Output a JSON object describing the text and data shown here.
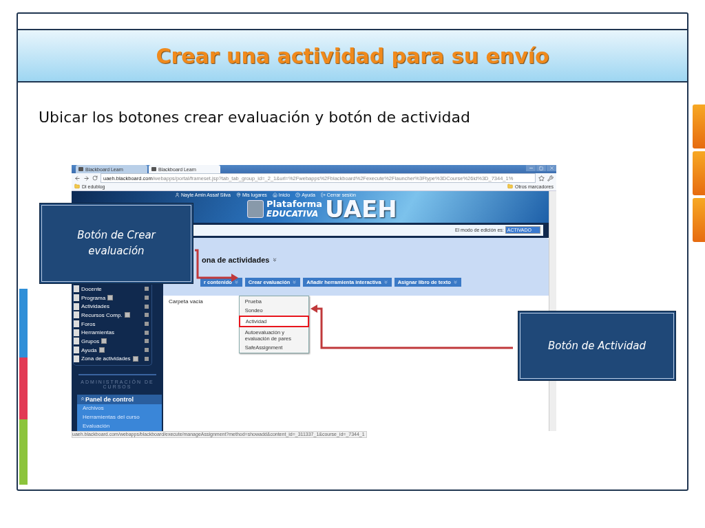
{
  "slide": {
    "title": "Crear una actividad para su envío",
    "subtitle": "Ubicar los botones crear evaluación y botón de actividad"
  },
  "browser": {
    "tabs": [
      {
        "label": "Blackboard Learn",
        "selected": false
      },
      {
        "label": "Blackboard Learn",
        "selected": true
      }
    ],
    "url_host": "uaeh.blackboard.com",
    "url_path": "/webapps/portal/frameset.jsp?tab_tab_group_id=_2_1&url=%2Fwebapps%2Fblackboard%2Fexecute%2Flauncher%3Ftype%3DCourse%26id%3D_7344_1%",
    "bookmark": "Dl edublog",
    "other_bookmarks": "Otros marcadores",
    "user_links": [
      "Nayte Amin Assaf Silva",
      "Mis lugares",
      "Inicio",
      "Ayuda",
      "Cerrar sesión"
    ],
    "logo": {
      "line1": "Plataforma",
      "line2": "EDUCATIVA",
      "brand": "UAEH"
    },
    "edit_mode": {
      "label": "El modo de edición es:",
      "value": "ACTIVADO",
      "on": true
    },
    "sidebar": {
      "items": [
        {
          "label": "Docente",
          "has_icon": false
        },
        {
          "label": "Programa",
          "has_icon": true
        },
        {
          "label": "Actividades",
          "has_icon": false
        },
        {
          "label": "Recursos Comp.",
          "has_icon": true
        },
        {
          "label": "Foros",
          "has_icon": false
        },
        {
          "label": "Herramientas",
          "has_icon": false
        },
        {
          "label": "Grupos",
          "has_icon": true
        },
        {
          "label": "Ayuda",
          "has_icon": true
        },
        {
          "label": "Zona de actividades",
          "has_icon": true
        }
      ],
      "admin_heading": "ADMINISTRACIÓN DE CURSOS",
      "panel": {
        "title": "Panel de control",
        "items": [
          "Archivos",
          "Herramientas del curso",
          "Evaluación"
        ]
      }
    },
    "content": {
      "heading": "ona de actividades",
      "buttons": [
        "r contenido",
        "Crear evaluación",
        "Añadir herramienta interactiva",
        "Asignar libro de texto"
      ],
      "menu": [
        {
          "label": "Prueba",
          "highlighted": false
        },
        {
          "label": "Sondeo",
          "highlighted": false
        },
        {
          "label": "Actividad",
          "highlighted": true
        },
        {
          "label": "Autoevaluación y evaluación de pares",
          "highlighted": false
        },
        {
          "label": "SafeAssignment",
          "highlighted": false
        }
      ],
      "empty_text": "Carpeta vacía"
    },
    "status_url": "uaeh.blackboard.com/webapps/blackboard/execute/manageAssignment?method=showadd&content_id=_311337_1&course_id=_7344_1"
  },
  "callouts": [
    "Botón de Crear evaluación",
    "Botón de Actividad"
  ]
}
